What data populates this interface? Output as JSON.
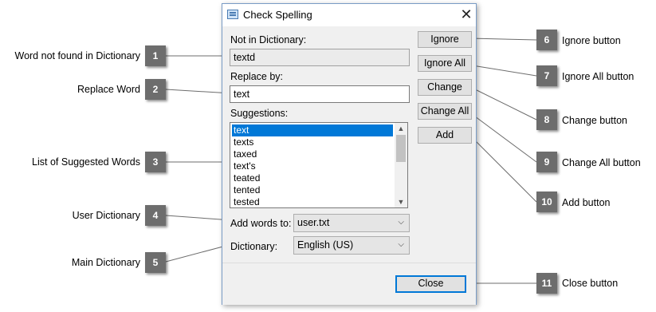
{
  "dialog": {
    "title": "Check Spelling",
    "close_glyph": "✕",
    "not_in_dictionary_label": "Not in Dictionary:",
    "not_in_dictionary_value": "textd",
    "replace_by_label": "Replace by:",
    "replace_by_value": "text",
    "suggestions_label": "Suggestions:",
    "suggestions": [
      "text",
      "texts",
      "taxed",
      "text's",
      "teated",
      "tented",
      "tested"
    ],
    "selected_suggestion": "text",
    "add_words_to_label": "Add words to:",
    "add_words_to_value": "user.txt",
    "dictionary_label": "Dictionary:",
    "dictionary_value": "English (US)",
    "buttons": {
      "ignore": "Ignore",
      "ignore_all": "Ignore All",
      "change": "Change",
      "change_all": "Change All",
      "add": "Add",
      "close": "Close"
    }
  },
  "callouts_left": [
    {
      "number": "1",
      "label": "Word not found in Dictionary"
    },
    {
      "number": "2",
      "label": "Replace Word"
    },
    {
      "number": "3",
      "label": "List of Suggested Words"
    },
    {
      "number": "4",
      "label": "User Dictionary"
    },
    {
      "number": "5",
      "label": "Main Dictionary"
    }
  ],
  "callouts_right": [
    {
      "number": "6",
      "label": "Ignore button"
    },
    {
      "number": "7",
      "label": "Ignore All button"
    },
    {
      "number": "8",
      "label": "Change button"
    },
    {
      "number": "9",
      "label": "Change All button"
    },
    {
      "number": "10",
      "label": "Add button"
    },
    {
      "number": "11",
      "label": "Close button"
    }
  ],
  "colors": {
    "callout_badge": "#6d6d6d",
    "selection": "#0078d7",
    "window_bg": "#f0f0f0"
  }
}
